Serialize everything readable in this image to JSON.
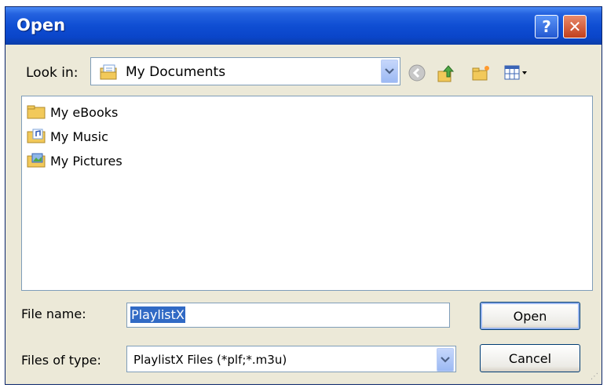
{
  "window": {
    "title": "Open"
  },
  "titlebar": {
    "help_symbol": "?",
    "close_symbol": "✕"
  },
  "lookin": {
    "label": "Look in:",
    "value": "My Documents"
  },
  "files": [
    {
      "name": "My eBooks",
      "icon": "folder-icon"
    },
    {
      "name": "My Music",
      "icon": "music-folder-icon"
    },
    {
      "name": "My Pictures",
      "icon": "pictures-folder-icon"
    }
  ],
  "filename": {
    "label": "File name:",
    "value": "PlaylistX"
  },
  "filetype": {
    "label": "Files of type:",
    "value": "PlaylistX Files (*plf;*.m3u)"
  },
  "buttons": {
    "open": "Open",
    "cancel": "Cancel"
  },
  "colors": {
    "titlebar": "#0a45c9",
    "dialog_bg": "#ece9d8",
    "selection": "#316ac5"
  }
}
